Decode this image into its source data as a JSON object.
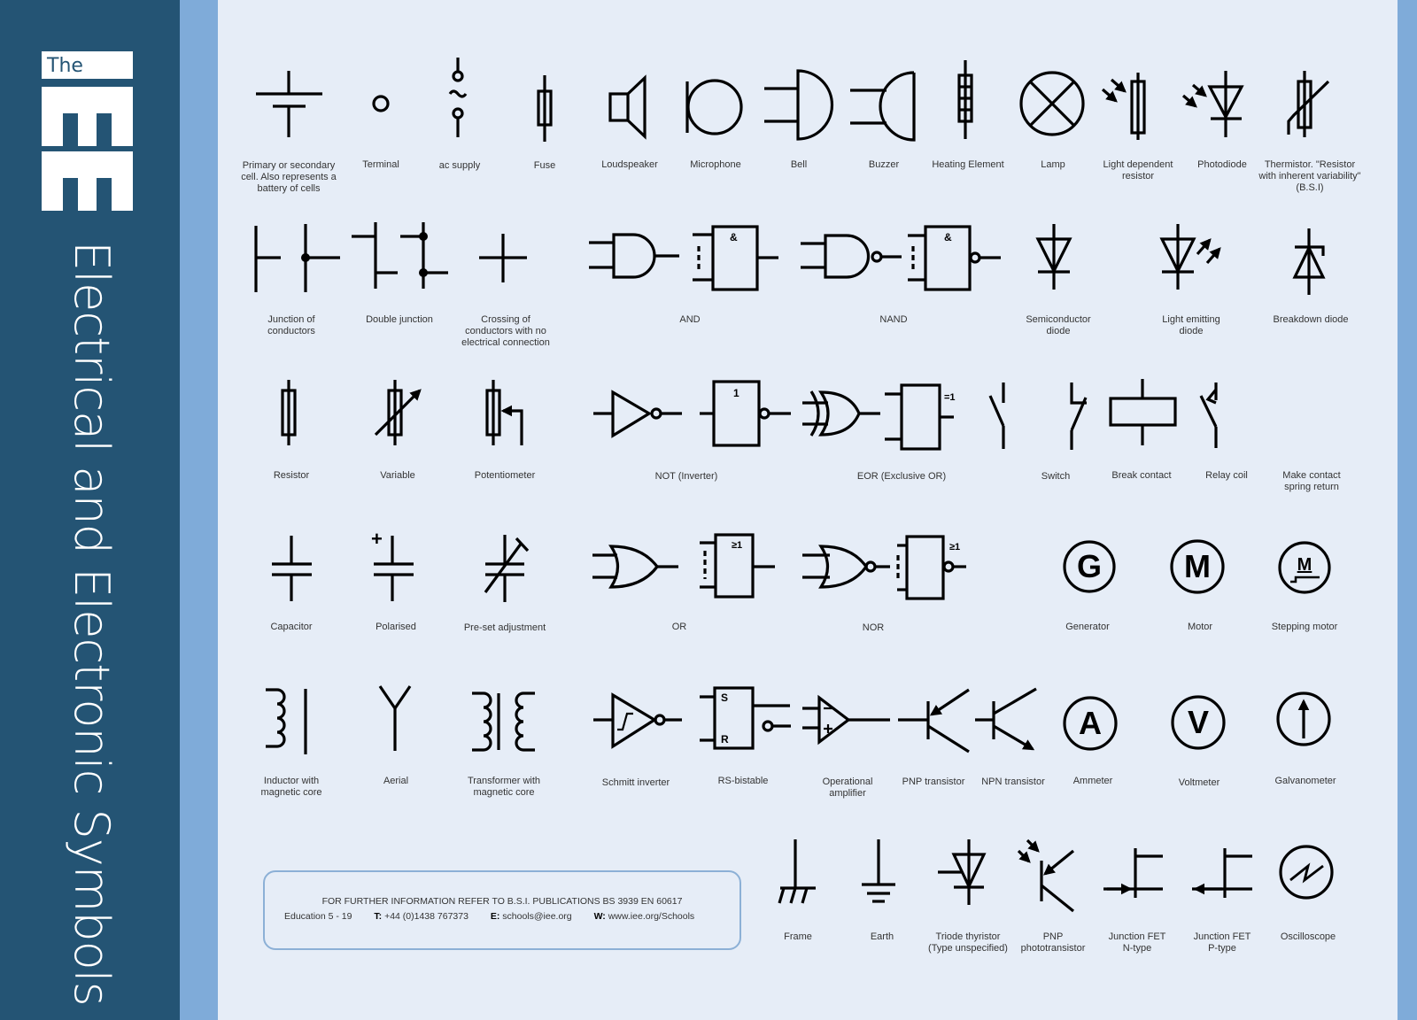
{
  "logo": {
    "small": "The",
    "large": "IEE"
  },
  "title": "Electrical and Electronic Symbols",
  "colors": {
    "sidebar": "#245474",
    "stripe": "#7fabd9",
    "background": "#e6edf7",
    "ink": "#000000"
  },
  "symbols": [
    {
      "id": "cell",
      "label": "Primary or secondary\ncell. Also represents a\nbattery of cells"
    },
    {
      "id": "terminal",
      "label": "Terminal"
    },
    {
      "id": "ac-supply",
      "label": "ac supply"
    },
    {
      "id": "fuse",
      "label": "Fuse"
    },
    {
      "id": "loudspeaker",
      "label": "Loudspeaker"
    },
    {
      "id": "microphone",
      "label": "Microphone"
    },
    {
      "id": "bell",
      "label": "Bell"
    },
    {
      "id": "buzzer",
      "label": "Buzzer"
    },
    {
      "id": "heating-element",
      "label": "Heating Element"
    },
    {
      "id": "lamp",
      "label": "Lamp"
    },
    {
      "id": "ldr",
      "label": "Light dependent\nresistor"
    },
    {
      "id": "photodiode",
      "label": "Photodiode"
    },
    {
      "id": "thermistor",
      "label": "Thermistor. \"Resistor\nwith inherent variability\"\n(B.S.I)"
    },
    {
      "id": "junction",
      "label": "Junction of\nconductors"
    },
    {
      "id": "double-junction",
      "label": "Double junction"
    },
    {
      "id": "crossing",
      "label": "Crossing of\nconductors with no\nelectrical connection"
    },
    {
      "id": "and",
      "label": "AND",
      "box_text": "&"
    },
    {
      "id": "nand",
      "label": "NAND",
      "box_text": "&"
    },
    {
      "id": "diode",
      "label": "Semiconductor\ndiode"
    },
    {
      "id": "led",
      "label": "Light emitting\ndiode"
    },
    {
      "id": "breakdown-diode",
      "label": "Breakdown diode"
    },
    {
      "id": "resistor",
      "label": "Resistor"
    },
    {
      "id": "variable",
      "label": "Variable"
    },
    {
      "id": "potentiometer",
      "label": "Potentiometer"
    },
    {
      "id": "not",
      "label": "NOT (Inverter)",
      "box_text": "1"
    },
    {
      "id": "eor",
      "label": "EOR (Exclusive OR)",
      "box_text": "=1"
    },
    {
      "id": "switch",
      "label": "Switch"
    },
    {
      "id": "break-contact",
      "label": "Break contact"
    },
    {
      "id": "relay-coil",
      "label": "Relay coil"
    },
    {
      "id": "make-contact",
      "label": "Make contact\nspring return"
    },
    {
      "id": "capacitor",
      "label": "Capacitor"
    },
    {
      "id": "polarised",
      "label": "Polarised",
      "mark": "+"
    },
    {
      "id": "preset",
      "label": "Pre-set adjustment"
    },
    {
      "id": "or",
      "label": "OR",
      "box_text": "≥1"
    },
    {
      "id": "nor",
      "label": "NOR",
      "box_text": "≥1"
    },
    {
      "id": "generator",
      "label": "Generator",
      "mark": "G"
    },
    {
      "id": "motor",
      "label": "Motor",
      "mark": "M"
    },
    {
      "id": "stepping-motor",
      "label": "Stepping motor",
      "mark": "M"
    },
    {
      "id": "inductor",
      "label": "Inductor with\nmagnetic core"
    },
    {
      "id": "aerial",
      "label": "Aerial"
    },
    {
      "id": "transformer",
      "label": "Transformer with\nmagnetic core"
    },
    {
      "id": "schmitt",
      "label": "Schmitt inverter"
    },
    {
      "id": "rs-bistable",
      "label": "RS-bistable",
      "s": "S",
      "r": "R"
    },
    {
      "id": "opamp",
      "label": "Operational\namplifier"
    },
    {
      "id": "pnp",
      "label": "PNP transistor"
    },
    {
      "id": "npn",
      "label": "NPN transistor"
    },
    {
      "id": "ammeter",
      "label": "Ammeter",
      "mark": "A"
    },
    {
      "id": "voltmeter",
      "label": "Voltmeter",
      "mark": "V"
    },
    {
      "id": "galvanometer",
      "label": "Galvanometer"
    },
    {
      "id": "frame",
      "label": "Frame"
    },
    {
      "id": "earth",
      "label": "Earth"
    },
    {
      "id": "thyristor",
      "label": "Triode thyristor\n(Type unspecified)"
    },
    {
      "id": "phototransistor",
      "label": "PNP\nphototransistor"
    },
    {
      "id": "jfet-n",
      "label": "Junction FET\nN-type"
    },
    {
      "id": "jfet-p",
      "label": "Junction FET\nP-type"
    },
    {
      "id": "oscilloscope",
      "label": "Oscilloscope"
    }
  ],
  "info": {
    "line1": "FOR FURTHER INFORMATION REFER TO B.S.I. PUBLICATIONS BS 3939 EN 60617",
    "education": "Education 5 - 19",
    "tel_label": "T:",
    "tel": "+44 (0)1438 767373",
    "email_label": "E:",
    "email": "schools@iee.org",
    "web_label": "W:",
    "web": "www.iee.org/Schools"
  }
}
